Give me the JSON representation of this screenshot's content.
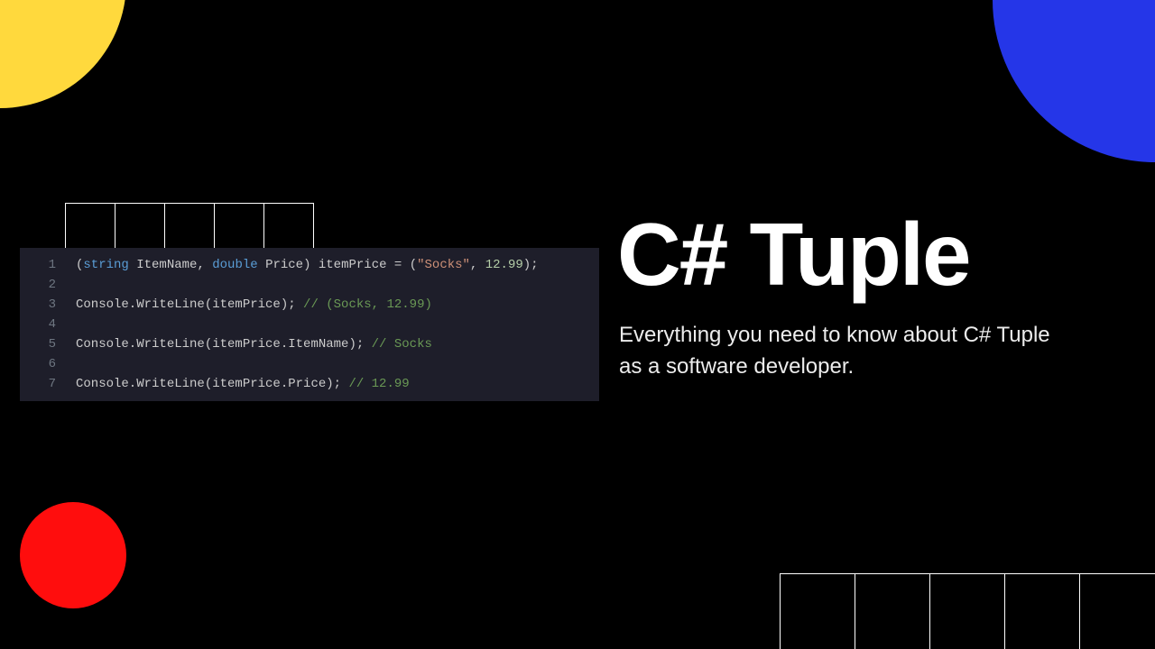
{
  "title": "C# Tuple",
  "subtitle": "Everything you need to know about C# Tuple as a software developer.",
  "code": {
    "lines": [
      {
        "num": "1",
        "tokens": [
          {
            "t": "(",
            "c": ""
          },
          {
            "t": "string",
            "c": "t-key"
          },
          {
            "t": " ItemName, ",
            "c": ""
          },
          {
            "t": "double",
            "c": "t-key"
          },
          {
            "t": " Price) itemPrice = (",
            "c": ""
          },
          {
            "t": "\"Socks\"",
            "c": "t-str"
          },
          {
            "t": ", ",
            "c": ""
          },
          {
            "t": "12.99",
            "c": "t-num"
          },
          {
            "t": ");",
            "c": ""
          }
        ]
      },
      {
        "num": "2",
        "tokens": []
      },
      {
        "num": "3",
        "tokens": [
          {
            "t": "Console.WriteLine(itemPrice); ",
            "c": ""
          },
          {
            "t": "// (Socks, 12.99)",
            "c": "t-cmt"
          }
        ]
      },
      {
        "num": "4",
        "tokens": []
      },
      {
        "num": "5",
        "tokens": [
          {
            "t": "Console.WriteLine(itemPrice.ItemName); ",
            "c": ""
          },
          {
            "t": "// Socks",
            "c": "t-cmt"
          }
        ]
      },
      {
        "num": "6",
        "tokens": []
      },
      {
        "num": "7",
        "tokens": [
          {
            "t": "Console.WriteLine(itemPrice.Price); ",
            "c": ""
          },
          {
            "t": "// 12.99",
            "c": "t-cmt"
          }
        ]
      }
    ]
  }
}
